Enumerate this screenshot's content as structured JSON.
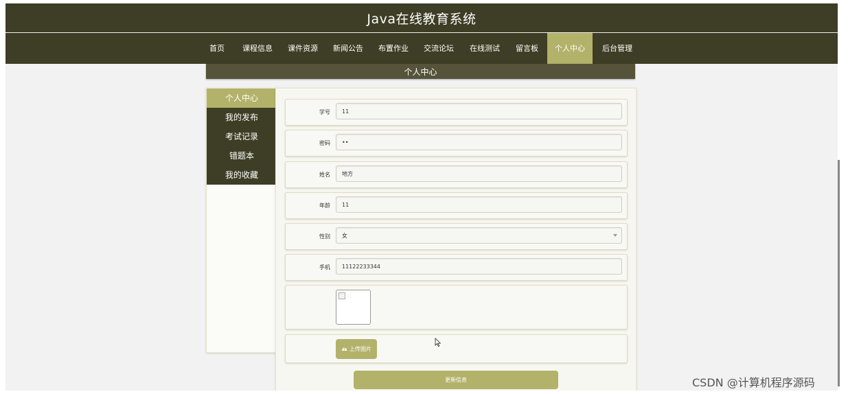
{
  "header": {
    "title": "Java在线教育系统"
  },
  "nav": {
    "items": [
      {
        "label": "首页"
      },
      {
        "label": "课程信息"
      },
      {
        "label": "课件资源"
      },
      {
        "label": "新闻公告"
      },
      {
        "label": "布置作业"
      },
      {
        "label": "交流论坛"
      },
      {
        "label": "在线测试"
      },
      {
        "label": "留言板"
      },
      {
        "label": "个人中心",
        "active": true
      },
      {
        "label": "后台管理"
      }
    ]
  },
  "section": {
    "title": "个人中心"
  },
  "sidebar": {
    "items": [
      {
        "label": "个人中心",
        "active": true
      },
      {
        "label": "我的发布"
      },
      {
        "label": "考试记录"
      },
      {
        "label": "错题本"
      },
      {
        "label": "我的收藏"
      }
    ]
  },
  "form": {
    "fields": [
      {
        "label": "学号",
        "value": "11"
      },
      {
        "label": "密码",
        "value": "••"
      },
      {
        "label": "姓名",
        "value": "地方"
      },
      {
        "label": "年龄",
        "value": "11"
      },
      {
        "label": "性别",
        "value": "女"
      },
      {
        "label": "手机",
        "value": "11122233344"
      }
    ],
    "upload_label": "上传图片",
    "submit_label": "更新信息"
  },
  "watermark": "CSDN @计算机程序源码",
  "colors": {
    "dark": "#3e3d25",
    "accent": "#b3b26a",
    "background": "#f2f2f2"
  },
  "icons": {
    "upload": "cloud-upload-icon",
    "cursor": "mouse-pointer-icon",
    "select": "chevron-down-icon",
    "image": "broken-image-icon"
  }
}
